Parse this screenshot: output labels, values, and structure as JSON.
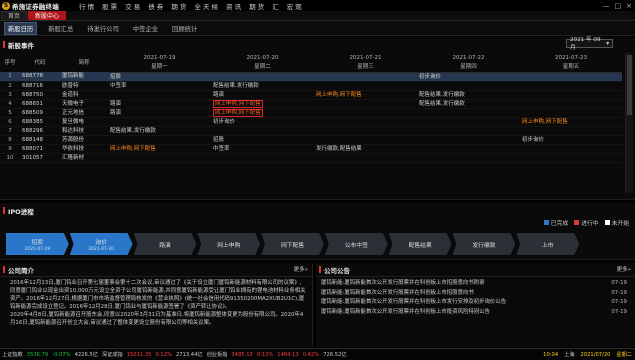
{
  "menubar": {
    "logo_char": "S",
    "logo_text": "希施证券融终端",
    "items": [
      "行 情",
      "股 票",
      "交 易",
      "债 券",
      "期 货",
      "全 天 候",
      "资 讯",
      "期 货",
      "汇",
      "宏 观"
    ],
    "window_controls": [
      "—",
      "□",
      "×"
    ]
  },
  "tabs": [
    "首页",
    "新股中心"
  ],
  "subnav": [
    "新股日历",
    "新股汇总",
    "待发行公司",
    "中签企业",
    "回顾统计"
  ],
  "newstock": {
    "title": "新股事件",
    "date_value": "2021 年 09 月",
    "columns": {
      "idx": "序号",
      "code": "代码",
      "name": "简称"
    },
    "dates": [
      {
        "date": "2021-07-19",
        "weekday": "星期一"
      },
      {
        "date": "2021-07-20",
        "weekday": "星期二"
      },
      {
        "date": "2021-07-21",
        "weekday": "星期三"
      },
      {
        "date": "2021-07-22",
        "weekday": "星期四"
      },
      {
        "date": "2021-07-23",
        "weekday": "星期五"
      }
    ],
    "rows": [
      {
        "idx": "1",
        "code": "688778",
        "name": "厦钨新能",
        "d1": "招股",
        "d2": "",
        "d3": "",
        "d4": "初步询价",
        "d5": ""
      },
      {
        "idx": "2",
        "code": "688716",
        "name": "欧普特",
        "d1": "中签率",
        "d2": "配售结果,发行缴款",
        "d3": "",
        "d4": "",
        "d5": ""
      },
      {
        "idx": "3",
        "code": "688750",
        "name": "金道科",
        "d1": "",
        "d2": "路演",
        "d3": "网上申购,网下配售",
        "d4": "配售结果,发行缴款",
        "d5": ""
      },
      {
        "idx": "4",
        "code": "688651",
        "name": "天微电子",
        "d1": "路演",
        "d2": "网上申购,网下配售",
        "d3": "",
        "d4": "配售结果,发行缴款",
        "d5": ""
      },
      {
        "idx": "5",
        "code": "688509",
        "name": "正元地信",
        "d1": "路演",
        "d2": "网上申购,网下配售",
        "d3": "",
        "d4": "",
        "d5": ""
      },
      {
        "idx": "6",
        "code": "688385",
        "name": "复旦微电",
        "d1": "",
        "d2": "初步询价",
        "d3": "",
        "d4": "",
        "d5": "网上申购,网下配售"
      },
      {
        "idx": "7",
        "code": "688296",
        "name": "和达科技",
        "d1": "配售结果,发行缴款",
        "d2": "",
        "d3": "",
        "d4": "",
        "d5": ""
      },
      {
        "idx": "8",
        "code": "688148",
        "name": "芳源股份",
        "d1": "",
        "d2": "招股",
        "d3": "",
        "d4": "",
        "d5": "初步询价"
      },
      {
        "idx": "9",
        "code": "688071",
        "name": "华依科技",
        "d1": "网上申购,网下配售",
        "d2": "中签率",
        "d3": "发行缴款,配售结果",
        "d4": "",
        "d5": ""
      },
      {
        "idx": "10",
        "code": "301057",
        "name": "汇隆新材",
        "d1": "",
        "d2": "",
        "d3": "",
        "d4": "",
        "d5": ""
      }
    ]
  },
  "ipo": {
    "title": "IPO进程",
    "legend": [
      "已完成",
      "进行中",
      "未开始"
    ],
    "legend_colors": [
      "#2a76c8",
      "#d33c3c",
      "#ffffff"
    ],
    "steps": [
      {
        "label": "招股",
        "date": "2021-07-19",
        "done": true
      },
      {
        "label": "询价",
        "date": "2021-07-20",
        "done": true
      },
      {
        "label": "路演",
        "date": "",
        "done": false
      },
      {
        "label": "网上申购",
        "date": "",
        "done": false
      },
      {
        "label": "网下配售",
        "date": "",
        "done": false
      },
      {
        "label": "公布中签",
        "date": "",
        "done": false
      },
      {
        "label": "配售结果",
        "date": "",
        "done": false
      },
      {
        "label": "发行缴款",
        "date": "",
        "done": false
      },
      {
        "label": "上市",
        "date": "",
        "done": false
      }
    ]
  },
  "company": {
    "title": "公司简介",
    "more": "更多»",
    "paragraphs": [
      "2016年12月13日,厦门钨业召开第七届董事会第十二次会议,审议通过了《关于设立厦门厦钨新能源材料有限公司的议案》,同意厦门钨业以现金出资10,000万元设立全资子公司厦钨新能源,并同意厦钨新能源受让厦门钨业拥有的锂电池材料业务相关资产。2016年12月27日,根据厦门市市场监督管理局核发的《营业执照》(统一社会信用代码91350200MA2XUB2U1C),厦钨新能源完成设立登记。2016年12月28日,厦门钨业与厦钨新能源签署了《资产转让协议》。",
      "2020年4月8日,厦钨新能源召开股东会,同意以2020年3月31日为基准日,将厦钨新能源整体变更为股份有限公司。2020年4月16日,厦钨新能源召开创立大会,审议通过了整体变更设立股份有限公司等相关议案。"
    ]
  },
  "notices": {
    "title": "公司公告",
    "more": "更多»",
    "items": [
      {
        "text": "厦钨新能:厦钨新能首次公开发行股票并在科创板上市招股意向书附录",
        "date": "07-19"
      },
      {
        "text": "厦钨新能:厦钨新能首次公开发行股票并在科创板上市招股意向书",
        "date": "07-19"
      },
      {
        "text": "厦钨新能:厦钨新能首次公开发行股票并在科创板上市发行安排及初步询价公告",
        "date": "07-19"
      },
      {
        "text": "厦钨新能:厦钨新能首次公开发行股票并在科创板上市投资风险特别公告",
        "date": "07-19"
      },
      {
        "text": "",
        "date": ""
      },
      {
        "text": "",
        "date": ""
      }
    ]
  },
  "statusbar": {
    "items": [
      {
        "label": "上证指数",
        "value": "3536.79",
        "change": "-0.07%",
        "amount": "4226.5亿",
        "dir": "dn"
      },
      {
        "label": "深证成指",
        "value": "15011.35",
        "change": "0.12%",
        "amount": "2713.44亿",
        "dir": "up"
      },
      {
        "label": "创业板指",
        "value": "3485.13",
        "change": "0.13%",
        "amount": "",
        "dir": "up"
      },
      {
        "label": "",
        "value": "1464.13",
        "change": "0.42%",
        "amount": "726.52亿",
        "dir": "up"
      }
    ],
    "right": [
      "10:04",
      "上海",
      "2021/07/20",
      "星期二"
    ]
  }
}
